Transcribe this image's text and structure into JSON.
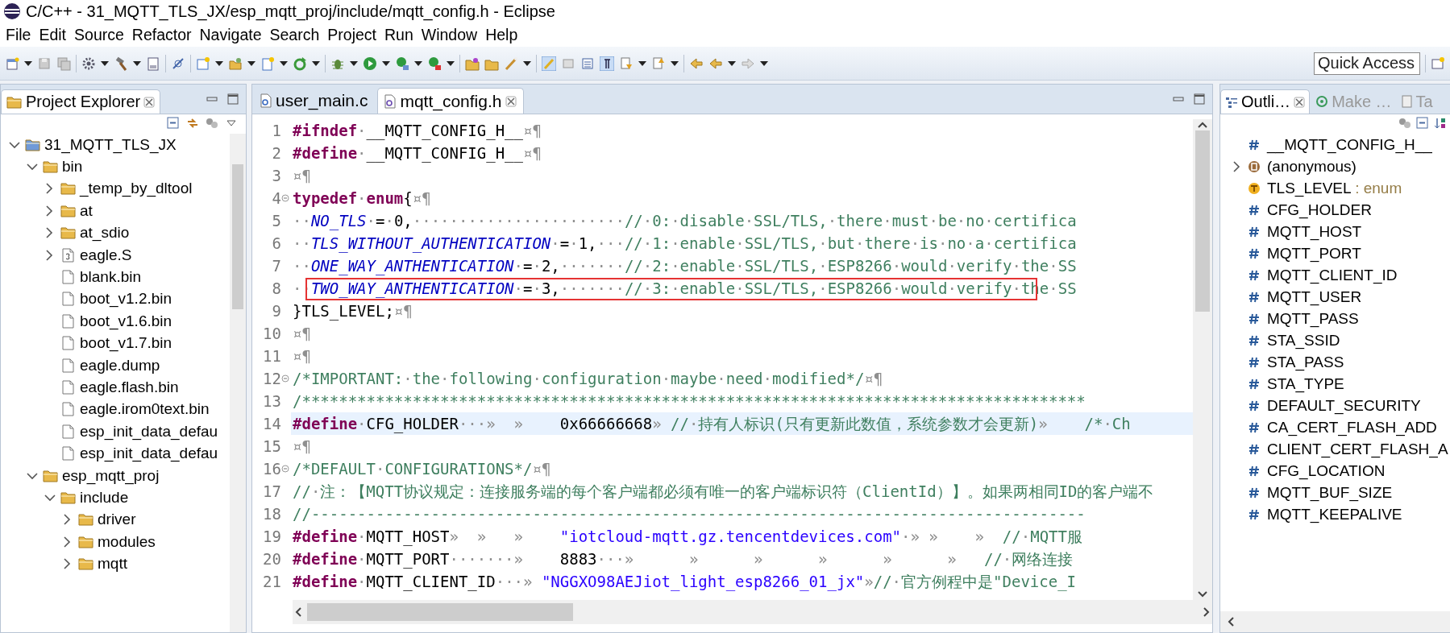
{
  "window": {
    "title": "C/C++ - 31_MQTT_TLS_JX/esp_mqtt_proj/include/mqtt_config.h - Eclipse"
  },
  "menu": [
    "File",
    "Edit",
    "Source",
    "Refactor",
    "Navigate",
    "Search",
    "Project",
    "Run",
    "Window",
    "Help"
  ],
  "quick_access": {
    "placeholder": "Quick Access"
  },
  "explorer": {
    "tabs": [
      {
        "label": "Project Explorer",
        "selected": true
      }
    ],
    "tree": [
      {
        "label": "31_MQTT_TLS_JX",
        "kind": "project",
        "expanded": true,
        "children": [
          {
            "label": "bin",
            "kind": "folder",
            "expanded": true,
            "children": [
              {
                "label": "_temp_by_dltool",
                "kind": "folder",
                "expanded": false
              },
              {
                "label": "at",
                "kind": "folder",
                "expanded": false
              },
              {
                "label": "at_sdio",
                "kind": "folder",
                "expanded": false
              },
              {
                "label": "eagle.S",
                "kind": "source",
                "expanded": false
              },
              {
                "label": "blank.bin",
                "kind": "file"
              },
              {
                "label": "boot_v1.2.bin",
                "kind": "file"
              },
              {
                "label": "boot_v1.6.bin",
                "kind": "file"
              },
              {
                "label": "boot_v1.7.bin",
                "kind": "file"
              },
              {
                "label": "eagle.dump",
                "kind": "file"
              },
              {
                "label": "eagle.flash.bin",
                "kind": "file"
              },
              {
                "label": "eagle.irom0text.bin",
                "kind": "file"
              },
              {
                "label": "esp_init_data_defau",
                "kind": "file"
              },
              {
                "label": "esp_init_data_defau",
                "kind": "file"
              }
            ]
          },
          {
            "label": "esp_mqtt_proj",
            "kind": "folder",
            "expanded": true,
            "children": [
              {
                "label": "include",
                "kind": "folder",
                "expanded": true,
                "children": [
                  {
                    "label": "driver",
                    "kind": "folder",
                    "expanded": false
                  },
                  {
                    "label": "modules",
                    "kind": "folder",
                    "expanded": false
                  },
                  {
                    "label": "mqtt",
                    "kind": "folder",
                    "expanded": false
                  }
                ]
              }
            ]
          }
        ]
      }
    ]
  },
  "editor": {
    "tabs": [
      {
        "label": "user_main.c",
        "kind": "c",
        "selected": false
      },
      {
        "label": "mqtt_config.h",
        "kind": "h",
        "selected": true
      }
    ],
    "lines": [
      {
        "number": "1",
        "foldable": false,
        "current": false,
        "boxed": false,
        "tokens": [
          {
            "kind": "kw",
            "text": "#ifndef"
          },
          {
            "kind": "ws",
            "text": "·"
          },
          {
            "kind": "plain",
            "text": "__MQTT_CONFIG_H__"
          },
          {
            "kind": "ws",
            "text": "¤¶"
          }
        ]
      },
      {
        "number": "2",
        "foldable": false,
        "current": false,
        "boxed": false,
        "tokens": [
          {
            "kind": "kw",
            "text": "#define"
          },
          {
            "kind": "ws",
            "text": "·"
          },
          {
            "kind": "plain",
            "text": "__MQTT_CONFIG_H__"
          },
          {
            "kind": "ws",
            "text": "¤¶"
          }
        ]
      },
      {
        "number": "3",
        "foldable": false,
        "current": false,
        "boxed": false,
        "tokens": [
          {
            "kind": "ws",
            "text": "¤¶"
          }
        ]
      },
      {
        "number": "4",
        "foldable": true,
        "current": false,
        "boxed": false,
        "tokens": [
          {
            "kind": "kw",
            "text": "typedef"
          },
          {
            "kind": "ws",
            "text": "·"
          },
          {
            "kind": "kw",
            "text": "enum"
          },
          {
            "kind": "plain",
            "text": "{"
          },
          {
            "kind": "ws",
            "text": "¤¶"
          }
        ]
      },
      {
        "number": "5",
        "foldable": false,
        "current": false,
        "boxed": false,
        "tokens": [
          {
            "kind": "ws",
            "text": "··"
          },
          {
            "kind": "enum",
            "text": "NO_TLS"
          },
          {
            "kind": "ws",
            "text": "·"
          },
          {
            "kind": "plain",
            "text": "="
          },
          {
            "kind": "ws",
            "text": "·"
          },
          {
            "kind": "plain",
            "text": "0,"
          },
          {
            "kind": "ws",
            "text": "·······················"
          },
          {
            "kind": "comment",
            "text": "//·0:·disable·SSL/TLS,·there·must·be·no·certifica"
          }
        ]
      },
      {
        "number": "6",
        "foldable": false,
        "current": false,
        "boxed": false,
        "tokens": [
          {
            "kind": "ws",
            "text": "··"
          },
          {
            "kind": "enum",
            "text": "TLS_WITHOUT_AUTHENTICATION"
          },
          {
            "kind": "ws",
            "text": "·"
          },
          {
            "kind": "plain",
            "text": "="
          },
          {
            "kind": "ws",
            "text": "·"
          },
          {
            "kind": "plain",
            "text": "1,"
          },
          {
            "kind": "ws",
            "text": "···"
          },
          {
            "kind": "comment",
            "text": "//·1:·enable·SSL/TLS,·but·there·is·no·a·certifica"
          }
        ]
      },
      {
        "number": "7",
        "foldable": false,
        "current": false,
        "boxed": false,
        "tokens": [
          {
            "kind": "ws",
            "text": "··"
          },
          {
            "kind": "enum",
            "text": "ONE_WAY_ANTHENTICATION"
          },
          {
            "kind": "ws",
            "text": "·"
          },
          {
            "kind": "plain",
            "text": "="
          },
          {
            "kind": "ws",
            "text": "·"
          },
          {
            "kind": "plain",
            "text": "2,"
          },
          {
            "kind": "ws",
            "text": "·······"
          },
          {
            "kind": "comment",
            "text": "//·2:·enable·SSL/TLS,·ESP8266·would·verify·the·SS"
          }
        ]
      },
      {
        "number": "8",
        "foldable": false,
        "current": false,
        "boxed": true,
        "tokens": [
          {
            "kind": "ws",
            "text": "··"
          },
          {
            "kind": "enum",
            "text": "TWO_WAY_ANTHENTICATION"
          },
          {
            "kind": "ws",
            "text": "·"
          },
          {
            "kind": "plain",
            "text": "="
          },
          {
            "kind": "ws",
            "text": "·"
          },
          {
            "kind": "plain",
            "text": "3,"
          },
          {
            "kind": "ws",
            "text": "·······"
          },
          {
            "kind": "comment",
            "text": "//·3:·enable·SSL/TLS,·ESP8266·would·verify·the·SS"
          }
        ]
      },
      {
        "number": "9",
        "foldable": false,
        "current": false,
        "boxed": false,
        "tokens": [
          {
            "kind": "plain",
            "text": "}TLS_LEVEL;"
          },
          {
            "kind": "ws",
            "text": "¤¶"
          }
        ]
      },
      {
        "number": "10",
        "foldable": false,
        "current": false,
        "boxed": false,
        "tokens": [
          {
            "kind": "ws",
            "text": "¤¶"
          }
        ]
      },
      {
        "number": "11",
        "foldable": false,
        "current": false,
        "boxed": false,
        "tokens": [
          {
            "kind": "ws",
            "text": "¤¶"
          }
        ]
      },
      {
        "number": "12",
        "foldable": true,
        "current": false,
        "boxed": false,
        "tokens": [
          {
            "kind": "comment",
            "text": "/*IMPORTANT:·the·following·configuration·maybe·need·modified*/"
          },
          {
            "kind": "ws",
            "text": "¤¶"
          }
        ]
      },
      {
        "number": "13",
        "foldable": false,
        "current": false,
        "boxed": false,
        "tokens": [
          {
            "kind": "comment",
            "text": "/*************************************************************************************"
          }
        ]
      },
      {
        "number": "14",
        "foldable": false,
        "current": true,
        "boxed": false,
        "tokens": [
          {
            "kind": "kw",
            "text": "#define"
          },
          {
            "kind": "ws",
            "text": "·"
          },
          {
            "kind": "plain",
            "text": "CFG_HOLDER"
          },
          {
            "kind": "ws",
            "text": "···»  »    "
          },
          {
            "kind": "plain",
            "text": "0x66666668"
          },
          {
            "kind": "ws",
            "text": "» "
          },
          {
            "kind": "comment",
            "text": "//·持有人标识(只有更新此数值，系统参数才会更新)"
          },
          {
            "kind": "ws",
            "text": "»    "
          },
          {
            "kind": "comment",
            "text": "/*·Ch"
          }
        ]
      },
      {
        "number": "15",
        "foldable": false,
        "current": false,
        "boxed": false,
        "tokens": [
          {
            "kind": "ws",
            "text": "¤¶"
          }
        ]
      },
      {
        "number": "16",
        "foldable": true,
        "current": false,
        "boxed": false,
        "tokens": [
          {
            "kind": "comment",
            "text": "/*DEFAULT·CONFIGURATIONS*/"
          },
          {
            "kind": "ws",
            "text": "¤¶"
          }
        ]
      },
      {
        "number": "17",
        "foldable": false,
        "current": false,
        "boxed": false,
        "tokens": [
          {
            "kind": "comment",
            "text": "//·注：【MQTT协议规定：连接服务端的每个客户端都必须有唯一的客户端标识符（ClientId）】。如果两相同ID的客户端不"
          }
        ]
      },
      {
        "number": "18",
        "foldable": false,
        "current": false,
        "boxed": false,
        "tokens": [
          {
            "kind": "comment",
            "text": "//------------------------------------------------------------------------------------"
          }
        ]
      },
      {
        "number": "19",
        "foldable": false,
        "current": false,
        "boxed": false,
        "tokens": [
          {
            "kind": "kw",
            "text": "#define"
          },
          {
            "kind": "ws",
            "text": "·"
          },
          {
            "kind": "plain",
            "text": "MQTT_HOST"
          },
          {
            "kind": "ws",
            "text": "»  »   »    "
          },
          {
            "kind": "string",
            "text": "\"iotcloud-mqtt.gz.tencentdevices.com\""
          },
          {
            "kind": "ws",
            "text": "·» »    »  "
          },
          {
            "kind": "comment",
            "text": "//·MQTT服"
          }
        ]
      },
      {
        "number": "20",
        "foldable": false,
        "current": false,
        "boxed": false,
        "tokens": [
          {
            "kind": "kw",
            "text": "#define"
          },
          {
            "kind": "ws",
            "text": "·"
          },
          {
            "kind": "plain",
            "text": "MQTT_PORT"
          },
          {
            "kind": "ws",
            "text": "·······»    "
          },
          {
            "kind": "plain",
            "text": "8883"
          },
          {
            "kind": "ws",
            "text": "···»      »      »      »      »      »   "
          },
          {
            "kind": "comment",
            "text": "//·网络连接"
          }
        ]
      },
      {
        "number": "21",
        "foldable": false,
        "current": false,
        "boxed": false,
        "tokens": [
          {
            "kind": "kw",
            "text": "#define"
          },
          {
            "kind": "ws",
            "text": "·"
          },
          {
            "kind": "plain",
            "text": "MQTT_CLIENT_ID"
          },
          {
            "kind": "ws",
            "text": "···» "
          },
          {
            "kind": "string",
            "text": "\"NGGXO98AEJiot_light_esp8266_01_jx\""
          },
          {
            "kind": "ws",
            "text": "»"
          },
          {
            "kind": "comment",
            "text": "//·官方例程中是\"Device_I"
          }
        ]
      }
    ]
  },
  "outline": {
    "tabs": [
      {
        "label": "Outli…",
        "kind": "outline",
        "selected": true
      },
      {
        "label": "Make …",
        "kind": "make",
        "selected": false
      },
      {
        "label": "Ta",
        "kind": "tasks",
        "selected": false
      }
    ],
    "items": [
      {
        "label": "__MQTT_CONFIG_H__",
        "kind": "macro"
      },
      {
        "label": "(anonymous)",
        "kind": "enum",
        "expanded": false
      },
      {
        "label": "TLS_LEVEL",
        "kind": "type",
        "type": ": enum"
      },
      {
        "label": "CFG_HOLDER",
        "kind": "macro"
      },
      {
        "label": "MQTT_HOST",
        "kind": "macro"
      },
      {
        "label": "MQTT_PORT",
        "kind": "macro"
      },
      {
        "label": "MQTT_CLIENT_ID",
        "kind": "macro"
      },
      {
        "label": "MQTT_USER",
        "kind": "macro"
      },
      {
        "label": "MQTT_PASS",
        "kind": "macro"
      },
      {
        "label": "STA_SSID",
        "kind": "macro"
      },
      {
        "label": "STA_PASS",
        "kind": "macro"
      },
      {
        "label": "STA_TYPE",
        "kind": "macro"
      },
      {
        "label": "DEFAULT_SECURITY",
        "kind": "macro"
      },
      {
        "label": "CA_CERT_FLASH_ADD",
        "kind": "macro"
      },
      {
        "label": "CLIENT_CERT_FLASH_A",
        "kind": "macro"
      },
      {
        "label": "CFG_LOCATION",
        "kind": "macro"
      },
      {
        "label": "MQTT_BUF_SIZE",
        "kind": "macro"
      },
      {
        "label": "MQTT_KEEPALIVE",
        "kind": "macro"
      }
    ]
  }
}
